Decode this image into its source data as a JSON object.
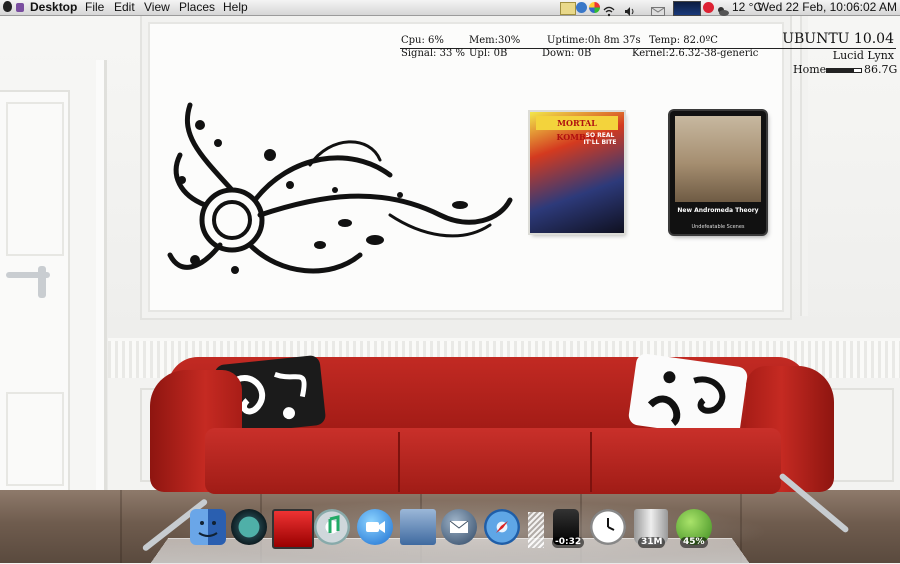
{
  "menubar": {
    "app_name": "Desktop",
    "menus": [
      "File",
      "Edit",
      "View",
      "Places",
      "Help"
    ],
    "weather": "12 °C",
    "clock": "Wed 22 Feb, 10:06:02 AM"
  },
  "conky": {
    "cpu": "Cpu: 6%",
    "mem": "Mem:30%",
    "uptime": "Uptime:0h 8m 37s",
    "temp": "Temp: 82.0ºC",
    "signal": "Signal:  33 %",
    "upl": "Upl:     0B",
    "down": "Down:     0B",
    "kernel": "Kernel:2.6.32-38-generic",
    "distro": "UBUNTU 10.04",
    "codename": "Lucid Lynx",
    "home_label": "Home",
    "home_size": "86.7G",
    "home_used_fraction": 0.8
  },
  "desktop": {
    "poster_title": "MORTAL KOMBAT",
    "poster_tagline": "SO REAL IT'LL BITE",
    "album_title": "New Andromeda Theory",
    "album_subtitle": "Undefeatable Scenes"
  },
  "dock": {
    "items": [
      {
        "name": "finder",
        "label": ""
      },
      {
        "name": "time-machine",
        "label": ""
      },
      {
        "name": "photo-booth",
        "label": ""
      },
      {
        "name": "itunes",
        "label": ""
      },
      {
        "name": "ichat",
        "label": ""
      },
      {
        "name": "preview",
        "label": ""
      },
      {
        "name": "mail",
        "label": ""
      },
      {
        "name": "safari",
        "label": ""
      },
      {
        "name": "media-player",
        "label": "-0:32"
      },
      {
        "name": "clock",
        "label": ""
      },
      {
        "name": "trash",
        "label": "31M"
      },
      {
        "name": "battery",
        "label": "45%"
      }
    ]
  },
  "colors": {
    "sofa": "#c22a23",
    "menubar": "#e4e4e4",
    "conky_text": "#111111"
  }
}
